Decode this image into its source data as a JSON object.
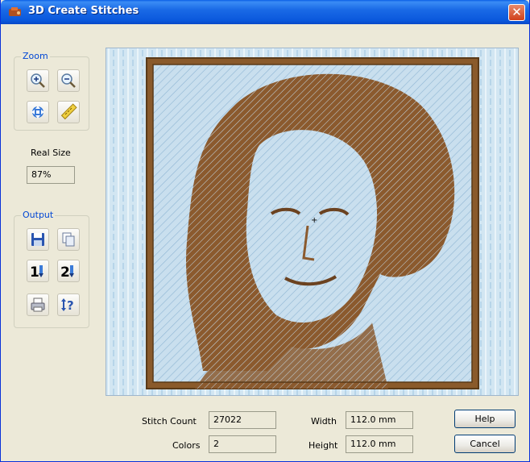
{
  "window": {
    "title": "3D Create Stitches",
    "close_glyph": "✕"
  },
  "zoom": {
    "label": "Zoom",
    "buttons": [
      "zoom-in-icon",
      "zoom-out-icon",
      "fit-icon",
      "ruler-icon"
    ],
    "real_size_label": "Real Size",
    "real_size_value": "87%"
  },
  "output": {
    "label": "Output",
    "buttons": [
      "save-icon",
      "copy-icon",
      "hoop-1-icon",
      "hoop-2-icon",
      "print-icon",
      "info-icon"
    ]
  },
  "stats": {
    "stitch_count_label": "Stitch Count",
    "stitch_count_value": "27022",
    "colors_label": "Colors",
    "colors_value": "2",
    "width_label": "Width",
    "width_value": "112.0 mm",
    "height_label": "Height",
    "height_value": "112.0 mm"
  },
  "buttons": {
    "help": "Help",
    "cancel": "Cancel"
  },
  "colors": {
    "frame_brown": "#8a5a2b",
    "stitch_brown": "#8b5a2e",
    "fabric_blue": "#cde2ef",
    "accent": "#0046d5"
  }
}
